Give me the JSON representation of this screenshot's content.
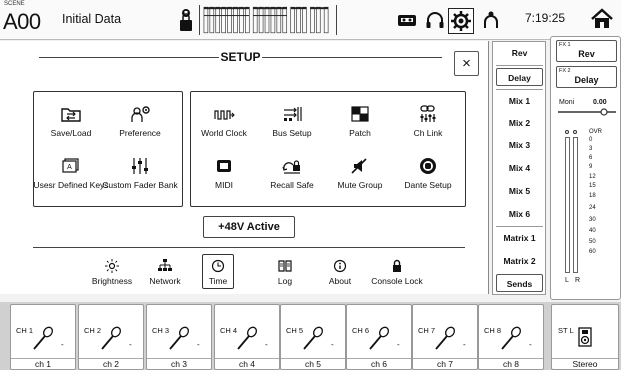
{
  "topbar": {
    "scene_label": "SCENE",
    "scene_number": "A00",
    "scene_name": "Initial Data",
    "time": "7:19:25"
  },
  "setup": {
    "title": "SETUP",
    "close": "×",
    "left_items": [
      {
        "label": "Save/Load",
        "icon": "folder-arrows-icon"
      },
      {
        "label": "Preference",
        "icon": "person-gear-icon"
      },
      {
        "label": "Usesr Defined Keys",
        "icon": "keys-icon"
      },
      {
        "label": "Custom Fader Bank",
        "icon": "faders-icon"
      }
    ],
    "right_items": [
      {
        "label": "World Clock",
        "icon": "clock-wave-icon"
      },
      {
        "label": "Bus Setup",
        "icon": "bus-icon"
      },
      {
        "label": "Patch",
        "icon": "patch-grid-icon"
      },
      {
        "label": "Ch Link",
        "icon": "link-icon"
      },
      {
        "label": "MIDI",
        "icon": "midi-icon"
      },
      {
        "label": "Recall Safe",
        "icon": "recall-lock-icon"
      },
      {
        "label": "Mute Group",
        "icon": "mute-speaker-icon"
      },
      {
        "label": "Dante Setup",
        "icon": "dante-icon"
      }
    ],
    "phantom_button": "+48V Active",
    "bottom_items": [
      {
        "label": "Brightness",
        "icon": "sun-icon"
      },
      {
        "label": "Network",
        "icon": "network-icon"
      },
      {
        "label": "Time",
        "icon": "clock-icon"
      },
      {
        "label": "Log",
        "icon": "book-icon"
      },
      {
        "label": "About",
        "icon": "info-icon"
      },
      {
        "label": "Console Lock",
        "icon": "padlock-icon"
      }
    ]
  },
  "buses": {
    "items": [
      "Rev",
      "Delay",
      "Mix 1",
      "Mix 2",
      "Mix 3",
      "Mix 4",
      "Mix 5",
      "Mix 6",
      "Matrix 1",
      "Matrix 2",
      "Sends"
    ]
  },
  "fx": {
    "fx1_label": "FX 1",
    "fx1_name": "Rev",
    "fx2_label": "FX 2",
    "fx2_name": "Delay",
    "moni_label": "Moni",
    "moni_value": "0.00",
    "meter_scale": [
      "OVR",
      "0",
      "3",
      "6",
      "9",
      "12",
      "15",
      "18",
      "24",
      "30",
      "40",
      "50",
      "60"
    ],
    "meter_left": "L",
    "meter_right": "R"
  },
  "channels": [
    {
      "num": "CH 1",
      "name": "ch 1",
      "level": "-"
    },
    {
      "num": "CH 2",
      "name": "ch 2",
      "level": "-"
    },
    {
      "num": "CH 3",
      "name": "ch 3",
      "level": "-"
    },
    {
      "num": "CH 4",
      "name": "ch 4",
      "level": "-"
    },
    {
      "num": "CH 5",
      "name": "ch 5",
      "level": "-"
    },
    {
      "num": "CH 6",
      "name": "ch 6",
      "level": "-"
    },
    {
      "num": "CH 7",
      "name": "ch 7",
      "level": "-"
    },
    {
      "num": "CH 8",
      "name": "ch 8",
      "level": "-"
    }
  ],
  "stereo": {
    "num": "ST L",
    "name": "Stereo"
  }
}
